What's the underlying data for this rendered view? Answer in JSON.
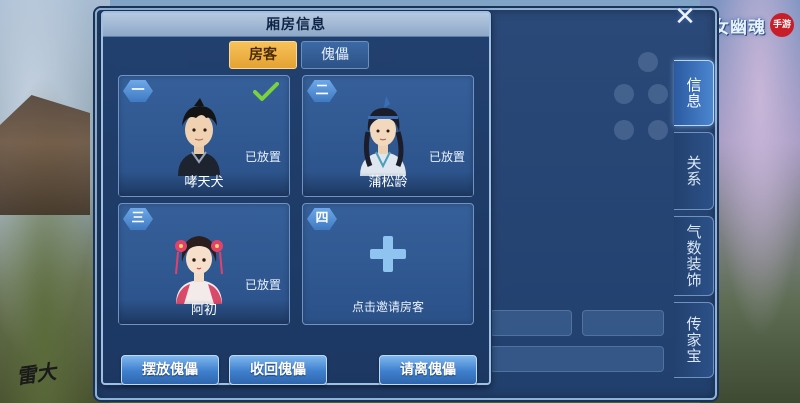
{
  "dialog": {
    "title": "厢房信息",
    "tabs": [
      {
        "label": "房客",
        "active": true
      },
      {
        "label": "傀儡",
        "active": false
      }
    ]
  },
  "rooms": [
    {
      "number": "一",
      "name": "哮天犬",
      "status": "已放置",
      "selected": true,
      "portrait": "male-black-hair"
    },
    {
      "number": "二",
      "name": "蒲松龄",
      "status": "已放置",
      "selected": false,
      "portrait": "male-scholar-headband"
    },
    {
      "number": "三",
      "name": "阿初",
      "status": "已放置",
      "selected": false,
      "portrait": "female-red-flowers"
    },
    {
      "number": "四",
      "empty": true,
      "invite_label": "点击邀请房客"
    }
  ],
  "buttons": {
    "place_puppet": "摆放傀儡",
    "recall_puppet": "收回傀儡",
    "evict": "请离傀儡"
  },
  "side_tabs": [
    {
      "label": "信息",
      "active": true
    },
    {
      "label": "关系",
      "active": false
    },
    {
      "label": "气数装饰",
      "active": false
    },
    {
      "label": "传家宝",
      "active": false
    }
  ],
  "logo": {
    "text": "倩女幽魂",
    "badge": "手游"
  },
  "signature": "雷大",
  "colors": {
    "accent_gold": "#f2b84a",
    "panel_blue": "#2b4f86",
    "button_blue": "#3e7fcd",
    "check_green": "#7ad23c"
  }
}
